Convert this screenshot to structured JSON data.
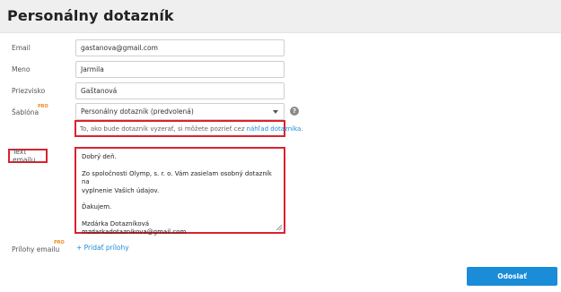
{
  "page": {
    "title": "Personálny dotazník"
  },
  "form": {
    "email": {
      "label": "Email",
      "value": "gastanova@gmail.com"
    },
    "name": {
      "label": "Meno",
      "value": "Jarmila"
    },
    "surname": {
      "label": "Priezvisko",
      "value": "Gaštanová"
    },
    "template": {
      "label": "Šablóna",
      "pro_badge": "PRO",
      "selected": "Personálny dotazník (predvolená)",
      "help": "?"
    },
    "hint": {
      "text": "To, ako bude dotazník vyzerať, si môžete pozrieť cez",
      "link": "náhľad dotazníka."
    },
    "email_text": {
      "label": "Text emailu",
      "lines": [
        "Dobrý deň.",
        "Zo spoločnosti Olymp, s. r. o. Vám zasielam osobný dotazník na",
        "vyplnenie Vašich údajov.",
        "Ďakujem.",
        "Mzdárka Dotazníková",
        "mzdarkadotaznikova@gmail.com"
      ]
    },
    "attachments": {
      "label": "Prílohy emailu",
      "pro_badge": "PRO",
      "add_link": "+ Pridať prílohy"
    },
    "submit_label": "Odoslať"
  },
  "colors": {
    "accent": "#1a8cd8",
    "pro": "#f08a1c",
    "highlight": "#d9232e"
  }
}
